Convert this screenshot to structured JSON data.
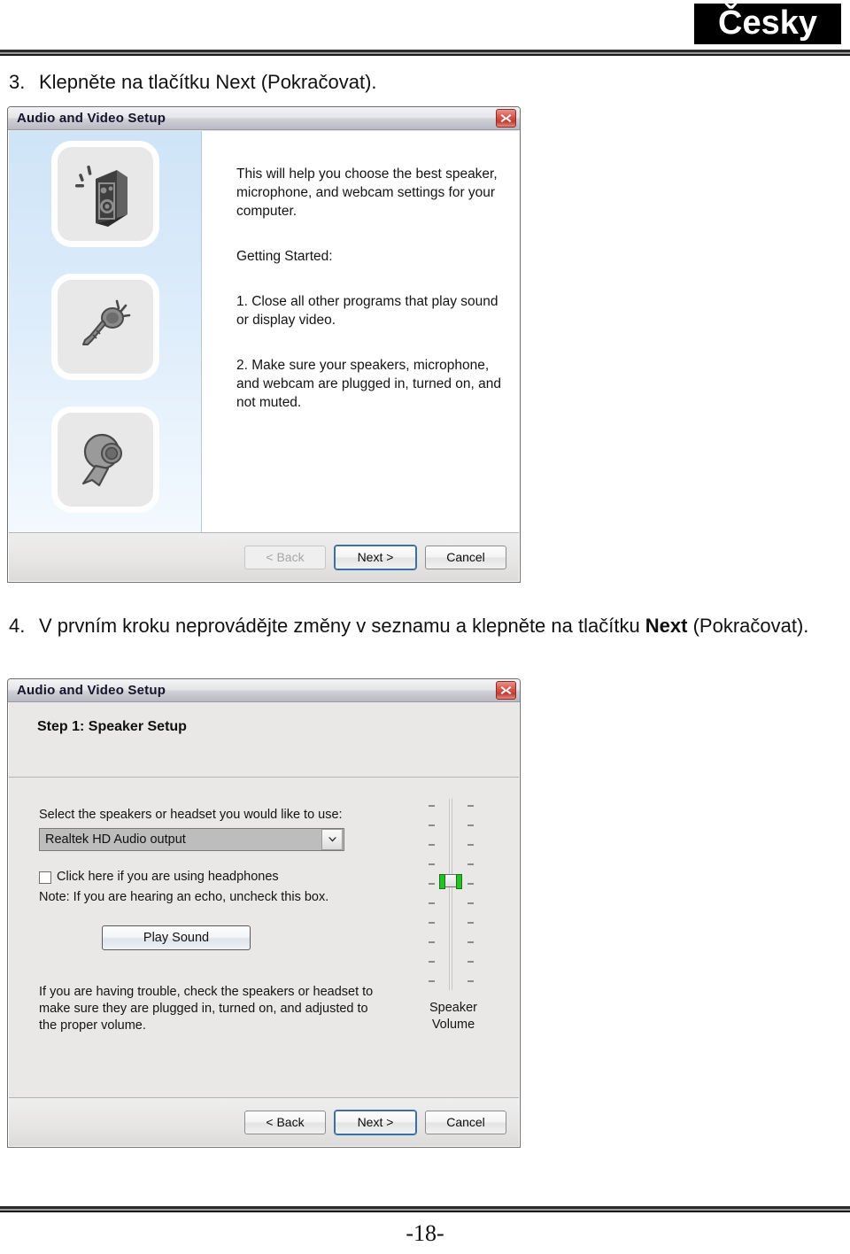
{
  "header": {
    "language_badge": "Česky"
  },
  "footer": {
    "page_number": "-18-"
  },
  "steps": [
    {
      "number": "3.",
      "text": "Klepněte na tlačítku Next (Pokračovat)."
    },
    {
      "number": "4.",
      "text_part1": "V prvním kroku neprovádějte změny v seznamu a klepněte na tlačítku ",
      "text_bold": "Next",
      "text_part2": " (Pokračovat)."
    }
  ],
  "dialog1": {
    "title": "Audio and Video Setup",
    "close_icon": "close-icon",
    "sidebar_icons": [
      {
        "name": "speaker-icon",
        "label": "speaker"
      },
      {
        "name": "microphone-icon",
        "label": "microphone"
      },
      {
        "name": "webcam-icon",
        "label": "webcam"
      }
    ],
    "paragraphs": [
      "This will help you choose the best speaker, microphone, and webcam settings for your computer.",
      "Getting Started:",
      "1. Close all other programs that play sound or display video.",
      "2. Make sure your speakers, microphone, and webcam are plugged in, turned on, and not muted."
    ],
    "buttons": {
      "back": "< Back",
      "next": "Next >",
      "cancel": "Cancel",
      "back_enabled": false
    }
  },
  "dialog2": {
    "title": "Audio and Video Setup",
    "close_icon": "close-icon",
    "step_header": "Step 1: Speaker Setup",
    "select_label": "Select the speakers or headset you would like to use:",
    "device_selected": "Realtek HD Audio output",
    "headphones_checkbox_label": "Click here if you are using headphones",
    "headphones_checked": false,
    "note": "Note: If you are hearing an echo, uncheck this box.",
    "play_sound_button": "Play Sound",
    "trouble_text": "If you are having trouble, check the speakers or headset to make sure they are plugged in, turned on, and adjusted to the proper volume.",
    "volume": {
      "caption_line1": "Speaker",
      "caption_line2": "Volume",
      "thumb_color": "#26c127"
    },
    "buttons": {
      "back": "< Back",
      "next": "Next >",
      "cancel": "Cancel",
      "back_enabled": true
    }
  }
}
